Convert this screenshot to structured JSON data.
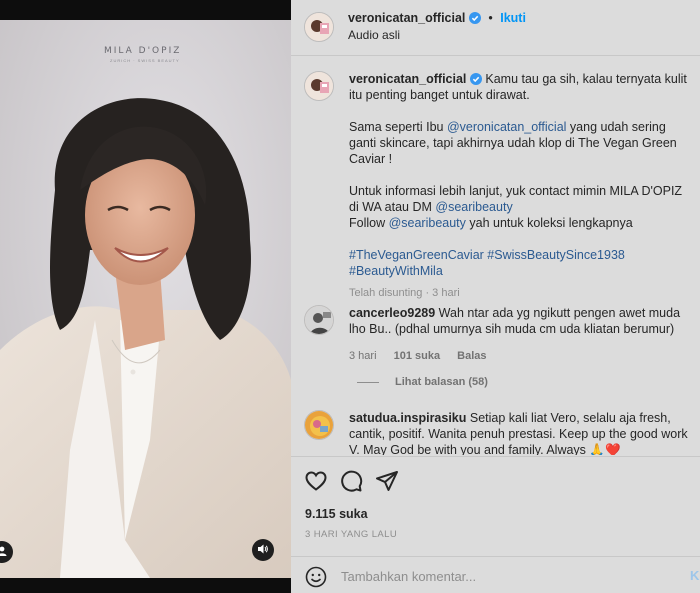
{
  "media": {
    "brand": "MILA D'OPIZ",
    "brand_sub": "ZURICH · SWISS BEAUTY",
    "user_icon": "user-icon",
    "audio_icon": "speaker-icon"
  },
  "header": {
    "username": "veronicatan_official",
    "follow_label": "Ikuti",
    "dot": "•",
    "subtitle": "Audio asli"
  },
  "caption": {
    "username": "veronicatan_official",
    "line1": "Kamu tau ga sih, kalau ternyata kulit itu penting banget untuk dirawat.",
    "p2_before": "Sama seperti Ibu ",
    "p2_mention": "@veronicatan_official",
    "p2_after": " yang udah sering ganti skincare, tapi akhirnya udah klop di The Vegan Green Caviar !",
    "p3_before": "Untuk informasi lebih lanjut, yuk contact mimin MILA D'OPIZ di WA atau DM ",
    "p3_mention": "@searibeauty",
    "p4_before": "Follow ",
    "p4_mention": "@searibeauty",
    "p4_after": " yah untuk koleksi lengkapnya",
    "hashtags": "#TheVeganGreenCaviar #SwissBeautySince1938 #BeautyWithMila",
    "edited": "Telah disunting · 3 hari"
  },
  "comments": [
    {
      "username": "cancerleo9289",
      "text": "Wah ntar ada yg ngikutt pengen awet muda lho Bu.. (pdhal umurnya sih muda cm uda kliatan berumur)",
      "time": "3 hari",
      "likes": "101 suka",
      "reply": "Balas",
      "view_replies": "Lihat balasan (58)"
    },
    {
      "username": "satudua.inspirasiku",
      "text": "Setiap kali liat Vero, selalu aja fresh, cantik, positif. Wanita penuh prestasi. Keep up the good work V. May God be with you and family. Always 🙏❤️"
    }
  ],
  "actions": {
    "like_icon": "heart-icon",
    "comment_icon": "comment-icon",
    "share_icon": "send-icon",
    "likes": "9.115 suka",
    "date": "3 HARI YANG LALU"
  },
  "comment_bar": {
    "emoji_icon": "emoji-icon",
    "placeholder": "Tambahkan komentar...",
    "post_label": "K"
  },
  "colors": {
    "panel_bg": "#dcdcdc",
    "link": "#2b5a91",
    "follow": "#0095f6",
    "verified": "#3797f0",
    "muted": "#8e8e8e"
  }
}
